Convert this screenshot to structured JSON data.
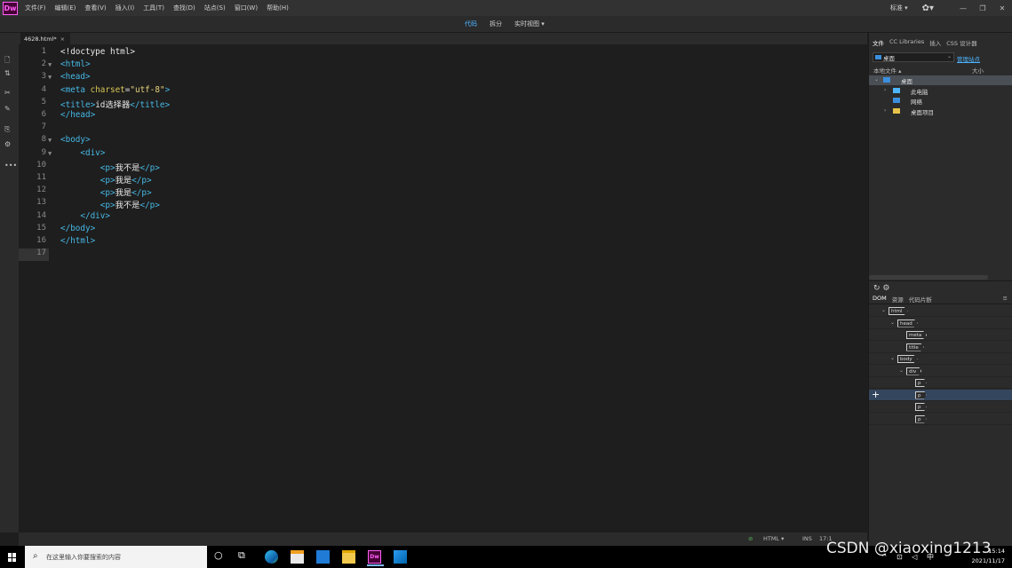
{
  "app": {
    "logo": "Dw"
  },
  "menu": [
    "文件(F)",
    "编辑(E)",
    "查看(V)",
    "插入(I)",
    "工具(T)",
    "查找(D)",
    "站点(S)",
    "窗口(W)",
    "帮助(H)"
  ],
  "menubar_right": {
    "layout": "标准 ▾",
    "gear": "✿▾",
    "window_buttons": [
      "—",
      "❐",
      "✕"
    ]
  },
  "views": {
    "code": "代码",
    "split": "拆分",
    "live": "实时视图 ▾"
  },
  "left_tools": [
    "🗋",
    "⇅",
    "✂",
    "✎",
    "⎘",
    "⚙",
    "•••"
  ],
  "document_tab": {
    "name": "4628.html*",
    "close": "×"
  },
  "editor": {
    "lines": [
      {
        "n": "1",
        "fold": "",
        "segs": [
          {
            "c": "tx",
            "t": "<!doctype html>"
          }
        ]
      },
      {
        "n": "2",
        "fold": "▼",
        "segs": [
          {
            "c": "t",
            "t": "<html>"
          }
        ]
      },
      {
        "n": "3",
        "fold": "▼",
        "segs": [
          {
            "c": "t",
            "t": "<head>"
          }
        ]
      },
      {
        "n": "4",
        "fold": "",
        "segs": [
          {
            "c": "t",
            "t": "<meta "
          },
          {
            "c": "a",
            "t": "charset"
          },
          {
            "c": "tx",
            "t": "="
          },
          {
            "c": "v",
            "t": "\"utf-8\""
          },
          {
            "c": "t",
            "t": ">"
          }
        ]
      },
      {
        "n": "5",
        "fold": "",
        "segs": [
          {
            "c": "t",
            "t": "<title>"
          },
          {
            "c": "tx",
            "t": "id选择器"
          },
          {
            "c": "t",
            "t": "</title>"
          }
        ]
      },
      {
        "n": "6",
        "fold": "",
        "segs": [
          {
            "c": "t",
            "t": "</head>"
          }
        ]
      },
      {
        "n": "7",
        "fold": "",
        "segs": []
      },
      {
        "n": "8",
        "fold": "▼",
        "segs": [
          {
            "c": "t",
            "t": "<body>"
          }
        ]
      },
      {
        "n": "9",
        "fold": "▼",
        "segs": [
          {
            "c": "t",
            "t": "    <div>"
          }
        ]
      },
      {
        "n": "10",
        "fold": "",
        "segs": [
          {
            "c": "t",
            "t": "        <p>"
          },
          {
            "c": "tx",
            "t": "我不是"
          },
          {
            "c": "t",
            "t": "</p>"
          }
        ]
      },
      {
        "n": "11",
        "fold": "",
        "segs": [
          {
            "c": "t",
            "t": "        <p>"
          },
          {
            "c": "tx",
            "t": "我是"
          },
          {
            "c": "t",
            "t": "</p>"
          }
        ]
      },
      {
        "n": "12",
        "fold": "",
        "segs": [
          {
            "c": "t",
            "t": "        <p>"
          },
          {
            "c": "tx",
            "t": "我是"
          },
          {
            "c": "t",
            "t": "</p>"
          }
        ]
      },
      {
        "n": "13",
        "fold": "",
        "segs": [
          {
            "c": "t",
            "t": "        <p>"
          },
          {
            "c": "tx",
            "t": "我不是"
          },
          {
            "c": "t",
            "t": "</p>"
          }
        ]
      },
      {
        "n": "14",
        "fold": "",
        "segs": [
          {
            "c": "t",
            "t": "    </div>"
          }
        ]
      },
      {
        "n": "15",
        "fold": "",
        "segs": [
          {
            "c": "t",
            "t": "</body>"
          }
        ]
      },
      {
        "n": "16",
        "fold": "",
        "segs": [
          {
            "c": "t",
            "t": "</html>"
          }
        ]
      },
      {
        "n": "17",
        "fold": "",
        "segs": [],
        "current": true
      }
    ]
  },
  "status": {
    "ok_icon": "⊘",
    "mode": "HTML ▾",
    "ins": "INS",
    "pos": "17:1"
  },
  "files_panel": {
    "tabs": [
      "文件",
      "CC Libraries",
      "插入",
      "CSS 设计器"
    ],
    "site": "桌面",
    "manage_link": "管理站点",
    "col_local": "本地文件 ▴",
    "col_size": "大小",
    "tree": [
      {
        "label": "桌面",
        "arrow": "⌄",
        "indent": 0,
        "icon_color": "#3b8fdc",
        "selected": true
      },
      {
        "label": "此电脑",
        "arrow": "›",
        "indent": 1,
        "icon_color": "#4db5ff",
        "selected": false
      },
      {
        "label": "网络",
        "arrow": "",
        "indent": 1,
        "icon_color": "#3b8fdc",
        "selected": false
      },
      {
        "label": "桌面项目",
        "arrow": "›",
        "indent": 1,
        "icon_color": "#e6c24a",
        "selected": false
      }
    ],
    "refresh": "↻ ⚙"
  },
  "dom_panel": {
    "tabs": [
      "DOM",
      "资源",
      "代码片断"
    ],
    "menu": "≡",
    "rows": [
      {
        "tag": "html",
        "arrow": "⌄",
        "indent": 0,
        "selected": false
      },
      {
        "tag": "head",
        "arrow": "⌄",
        "indent": 1,
        "selected": false
      },
      {
        "tag": "meta",
        "arrow": "",
        "indent": 2,
        "selected": false
      },
      {
        "tag": "title",
        "arrow": "",
        "indent": 2,
        "selected": false
      },
      {
        "tag": "body",
        "arrow": "⌄",
        "indent": 1,
        "selected": false
      },
      {
        "tag": "div",
        "arrow": "⌄",
        "indent": 2,
        "selected": false
      },
      {
        "tag": "p",
        "arrow": "",
        "indent": 3,
        "selected": false
      },
      {
        "tag": "p",
        "arrow": "",
        "indent": 3,
        "selected": true
      },
      {
        "tag": "p",
        "arrow": "",
        "indent": 3,
        "selected": false
      },
      {
        "tag": "p",
        "arrow": "",
        "indent": 3,
        "selected": false
      }
    ],
    "plus": "+"
  },
  "taskbar": {
    "search_placeholder": "在这里输入你要搜索的内容",
    "search_icon": "⌕",
    "cortana": "○",
    "taskview": "⧉",
    "tray_icons": "^ ⊡ ◁ 中",
    "time": "15:14",
    "date": "2021/11/17",
    "dw_label": "Dw"
  },
  "watermark": "CSDN @xiaoxing1213"
}
